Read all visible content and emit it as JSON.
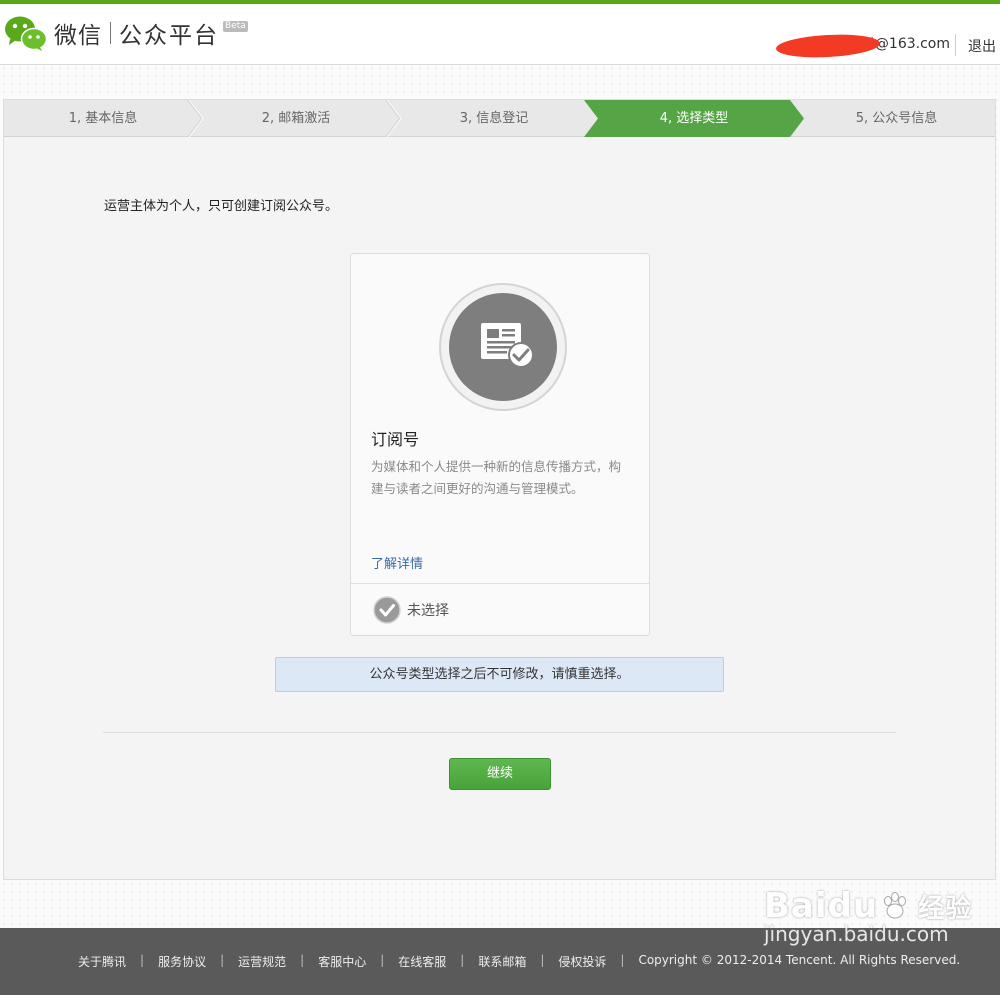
{
  "header": {
    "brand": "微信",
    "brand_sub": "公众平台",
    "beta": "Beta",
    "account": "5@163.com",
    "logout": "退出"
  },
  "steps": [
    {
      "label": "1, 基本信息",
      "active": false
    },
    {
      "label": "2, 邮箱激活",
      "active": false
    },
    {
      "label": "3, 信息登记",
      "active": false
    },
    {
      "label": "4, 选择类型",
      "active": true
    },
    {
      "label": "5, 公众号信息",
      "active": false
    }
  ],
  "intro": "运营主体为个人，只可创建订阅公众号。",
  "card": {
    "title": "订阅号",
    "description": "为媒体和个人提供一种新的信息传播方式，构建与读者之间更好的沟通与管理模式。",
    "link": "了解详情",
    "state": "未选择"
  },
  "notice": "公众号类型选择之后不可修改，请慎重选择。",
  "continue_label": "继续",
  "footer": {
    "links": [
      "关于腾讯",
      "服务协议",
      "运营规范",
      "客服中心",
      "在线客服",
      "联系邮箱",
      "侵权投诉"
    ],
    "copyright": "Copyright © 2012-2014 Tencent. All Rights Reserved."
  },
  "watermark": {
    "brand": "Baidu",
    "cn": "经验",
    "url": "jingyan.baidu.com"
  },
  "colors": {
    "accent": "#58a718",
    "active_step": "#55a546",
    "button": "#48a33a",
    "link": "#386aa8",
    "notice_bg": "#dde8f6"
  }
}
